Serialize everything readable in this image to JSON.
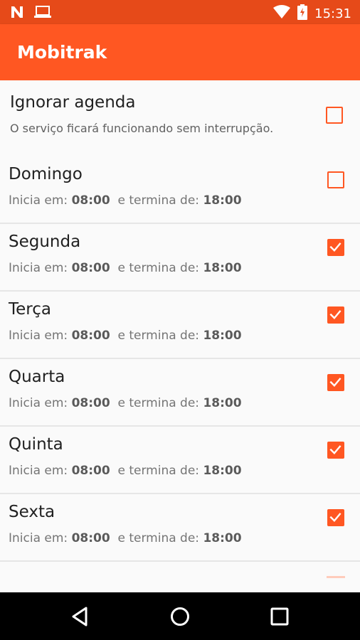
{
  "status_bar": {
    "time": "15:31",
    "icons": [
      "notification-n-icon",
      "laptop-icon",
      "wifi-icon",
      "battery-charging-icon"
    ]
  },
  "app_bar": {
    "title": "Mobitrak"
  },
  "ignore_schedule": {
    "title": "Ignorar agenda",
    "subtitle": "O serviço ficará funcionando sem interrupção.",
    "checked": false
  },
  "labels": {
    "starts": "Inicia em:",
    "ends": "e termina de:"
  },
  "days": [
    {
      "name": "Domingo",
      "start": "08:00",
      "end": "18:00",
      "checked": false
    },
    {
      "name": "Segunda",
      "start": "08:00",
      "end": "18:00",
      "checked": true
    },
    {
      "name": "Terça",
      "start": "08:00",
      "end": "18:00",
      "checked": true
    },
    {
      "name": "Quarta",
      "start": "08:00",
      "end": "18:00",
      "checked": true
    },
    {
      "name": "Quinta",
      "start": "08:00",
      "end": "18:00",
      "checked": true
    },
    {
      "name": "Sexta",
      "start": "08:00",
      "end": "18:00",
      "checked": true
    }
  ],
  "colors": {
    "primary": "#ff5722",
    "primary_dark": "#e64a19"
  },
  "nav_bar": {
    "icons": [
      "back-icon",
      "home-icon",
      "recents-icon"
    ]
  }
}
